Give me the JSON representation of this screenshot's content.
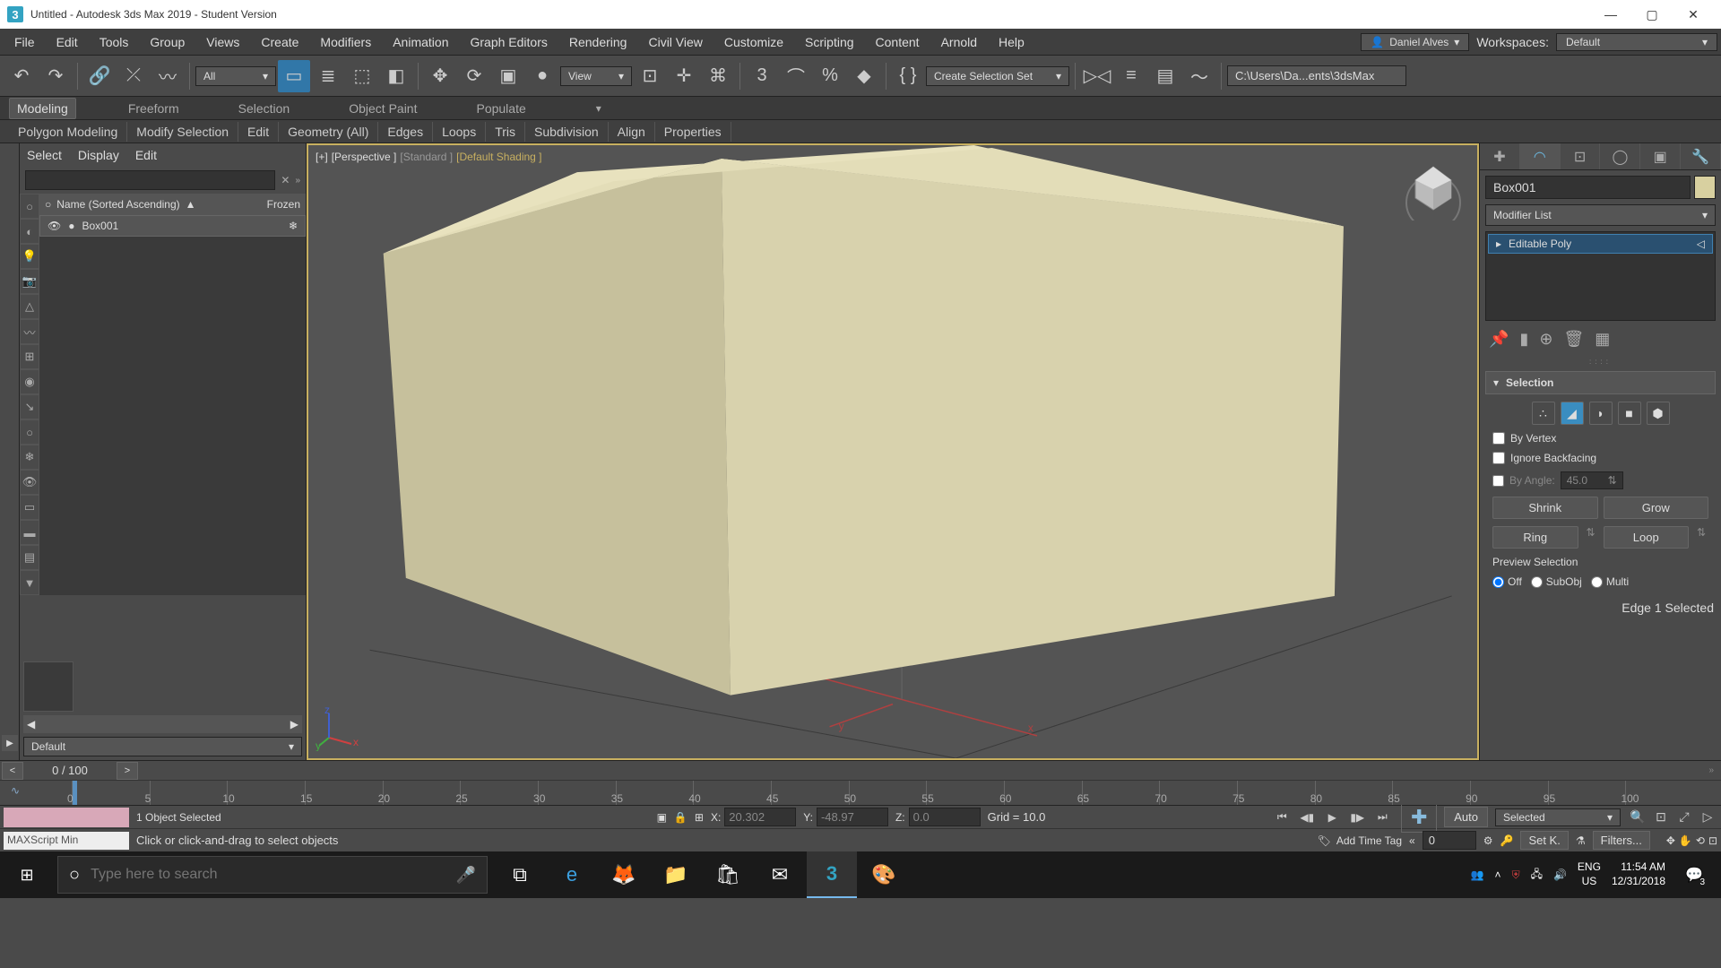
{
  "titlebar": {
    "app_glyph": "3",
    "title": "Untitled - Autodesk 3ds Max 2019 - Student Version"
  },
  "menu": [
    "File",
    "Edit",
    "Tools",
    "Group",
    "Views",
    "Create",
    "Modifiers",
    "Animation",
    "Graph Editors",
    "Rendering",
    "Civil View",
    "Customize",
    "Scripting",
    "Content",
    "Arnold",
    "Help"
  ],
  "user": {
    "name": "Daniel Alves"
  },
  "workspaces": {
    "label": "Workspaces:",
    "value": "Default"
  },
  "toolbar": {
    "dropdown_all": "All",
    "dropdown_view": "View",
    "sel_set_placeholder": "Create Selection Set",
    "path": "C:\\Users\\Da...ents\\3dsMax"
  },
  "ribbon_tabs": [
    "Modeling",
    "Freeform",
    "Selection",
    "Object Paint",
    "Populate"
  ],
  "subribbon": [
    "Polygon Modeling",
    "Modify Selection",
    "Edit",
    "Geometry (All)",
    "Edges",
    "Loops",
    "Tris",
    "Subdivision",
    "Align",
    "Properties"
  ],
  "scene_panel": {
    "menu": [
      "Select",
      "Display",
      "Edit"
    ],
    "header_name": "Name (Sorted Ascending)",
    "header_frozen": "Frozen",
    "item": "Box001",
    "layer": "Default"
  },
  "viewport": {
    "plus": "[+]",
    "persp": "[Perspective ]",
    "std": "[Standard ]",
    "shade": "[Default Shading ]",
    "axis": {
      "x": "x",
      "y": "y",
      "z": "z"
    }
  },
  "cmd": {
    "obj_name": "Box001",
    "mod_list": "Modifier List",
    "modifier": "Editable Poly",
    "rollout": "Selection",
    "by_vertex": "By Vertex",
    "ignore_bf": "Ignore Backfacing",
    "by_angle": "By Angle:",
    "angle_val": "45.0",
    "shrink": "Shrink",
    "grow": "Grow",
    "ring": "Ring",
    "loop": "Loop",
    "preview": "Preview Selection",
    "off": "Off",
    "subobj": "SubObj",
    "multi": "Multi",
    "status": "Edge 1 Selected"
  },
  "timeline": {
    "frame": "0 / 100",
    "ticks": [
      "0",
      "5",
      "10",
      "15",
      "20",
      "25",
      "30",
      "35",
      "40",
      "45",
      "50",
      "55",
      "60",
      "65",
      "70",
      "75",
      "80",
      "85",
      "90",
      "95",
      "100"
    ]
  },
  "status": {
    "sel": "1 Object Selected",
    "x_label": "X:",
    "x": "20.302",
    "y_label": "Y:",
    "y": "-48.97",
    "z_label": "Z:",
    "z": "0.0",
    "grid": "Grid = 10.0",
    "auto": "Auto",
    "selected": "Selected",
    "setk": "Set K.",
    "filters": "Filters...",
    "addtag": "Add Time Tag",
    "spin": "0",
    "maxscript": "MAXScript Min",
    "prompt": "Click or click-and-drag to select objects"
  },
  "taskbar": {
    "search_placeholder": "Type here to search",
    "lang1": "ENG",
    "lang2": "US",
    "time": "11:54 AM",
    "date": "12/31/2018",
    "noti": "3"
  }
}
